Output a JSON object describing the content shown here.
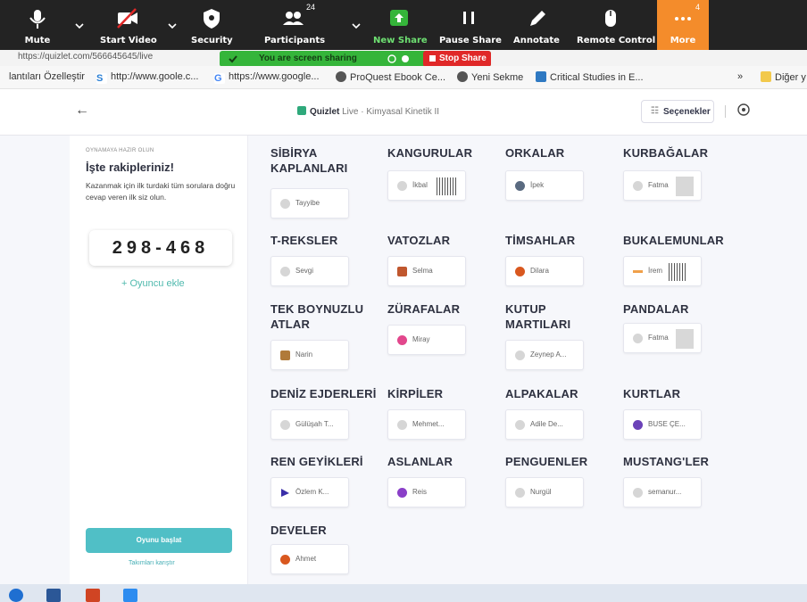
{
  "zoom": {
    "buttons": [
      {
        "label": "Mute",
        "icon": "microphone-icon"
      },
      {
        "label": "Start Video",
        "icon": "video-off-icon"
      },
      {
        "label": "Security",
        "icon": "shield-icon"
      },
      {
        "label": "Participants",
        "icon": "participants-icon"
      },
      {
        "label": "New Share",
        "icon": "share-screen-icon"
      },
      {
        "label": "Pause Share",
        "icon": "pause-icon"
      },
      {
        "label": "Annotate",
        "icon": "pencil-icon"
      },
      {
        "label": "Remote Control",
        "icon": "mouse-icon"
      },
      {
        "label": "More",
        "icon": "ellipsis-icon"
      }
    ],
    "participants_count": "24",
    "more_badge": "4",
    "colors": {
      "toolbar": "#232323",
      "more": "#f48c2b",
      "new_share": "#35b53a"
    }
  },
  "share_banner": {
    "text": "You are screen sharing",
    "stop_label": "Stop Share",
    "colors": {
      "banner": "#35b53a",
      "stop": "#e02828"
    }
  },
  "browser": {
    "partial_url": "https://quizlet.com/566645645/live",
    "bookmarks": [
      {
        "label": "lantıları Özelleştir",
        "icon": "none"
      },
      {
        "label": "http://www.goole.c...",
        "icon": "s-bookmark-icon"
      },
      {
        "label": "https://www.google...",
        "icon": "google-icon"
      },
      {
        "label": "ProQuest Ebook Ce...",
        "icon": "globe-icon"
      },
      {
        "label": "Yeni Sekme",
        "icon": "globe-icon"
      },
      {
        "label": "Critical Studies in E...",
        "icon": "tf-icon"
      }
    ],
    "overflow": "»",
    "other_bookmarks": "Diğer y"
  },
  "header": {
    "back": "←",
    "brand": "Quizlet",
    "brand_suffix": "Live",
    "title": " · Kimyasal Kinetik II",
    "options_label": "Seçenekler",
    "info": "?"
  },
  "sidebar": {
    "ready_label": "OYNAMAYA HAZIR OLUN",
    "heading": "İşte rakipleriniz!",
    "description": "Kazanmak için ilk turdaki tüm sorulara doğru cevap veren ilk siz olun.",
    "join_code": "298-468",
    "add_player": "+ Oyuncu ekle",
    "start_game": "Oyunu başlat",
    "shuffle_teams": "Takımları karıştır"
  },
  "teams": [
    {
      "name": "SİBİRYA KAPLANLARI",
      "player": "Tayyibe",
      "icon": "default-avatar-icon"
    },
    {
      "name": "KANGURULAR",
      "player": "İkbal",
      "icon": "default-avatar-icon"
    },
    {
      "name": "ORKALAR",
      "player": "İpek",
      "icon": "info-avatar-icon"
    },
    {
      "name": "KURBAĞALAR",
      "player": "Fatma",
      "icon": "default-avatar-icon"
    },
    {
      "name": "T-REKSLER",
      "player": "Sevgi",
      "icon": "default-avatar-icon"
    },
    {
      "name": "VATOZLAR",
      "player": "Selma",
      "icon": "bird-avatar-icon"
    },
    {
      "name": "TİMSAHLAR",
      "player": "Dilara",
      "icon": "orange-avatar-icon"
    },
    {
      "name": "BUKALEMUNLAR",
      "player": "İrem",
      "icon": "arrow-avatar-icon"
    },
    {
      "name": "TEK BOYNUZLU ATLAR",
      "player": "Narin",
      "icon": "animal-avatar-icon"
    },
    {
      "name": "ZÜRAFALAR",
      "player": "Miray",
      "icon": "pink-avatar-icon"
    },
    {
      "name": "KUTUP MARTILARI",
      "player": "Zeynep A...",
      "icon": "default-avatar-icon"
    },
    {
      "name": "PANDALAR",
      "player": "Fatma",
      "icon": "default-avatar-icon"
    },
    {
      "name": "DENİZ EJDERLERİ",
      "player": "Gülüşah T...",
      "icon": "default-avatar-icon"
    },
    {
      "name": "KİRPİLER",
      "player": "Mehmet...",
      "icon": "default-avatar-icon"
    },
    {
      "name": "ALPAKALAR",
      "player": "Adile De...",
      "icon": "default-avatar-icon"
    },
    {
      "name": "KURTLAR",
      "player": "BUSE ÇE...",
      "icon": "purple-avatar-icon"
    },
    {
      "name": "REN GEYİKLERİ",
      "player": "Özlem K...",
      "icon": "play-avatar-icon"
    },
    {
      "name": "ASLANLAR",
      "player": "Reis",
      "icon": "purple-avatar-icon"
    },
    {
      "name": "PENGUENLER",
      "player": "Nurgül",
      "icon": "default-avatar-icon"
    },
    {
      "name": "MUSTANG'LER",
      "player": "semanur...",
      "icon": "default-avatar-icon"
    },
    {
      "name": "DEVELER",
      "player": "Ahmet",
      "icon": "orange-avatar-icon"
    }
  ],
  "taskbar": {
    "apps": [
      "windows-logo-icon",
      "word-icon",
      "powerpoint-icon",
      "chat-icon"
    ]
  }
}
